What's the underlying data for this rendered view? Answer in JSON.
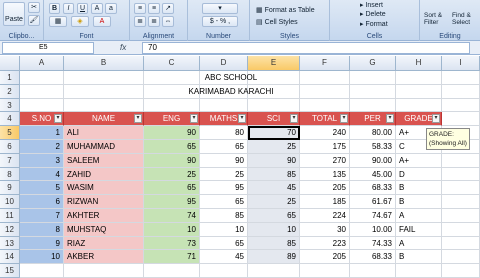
{
  "ribbon": {
    "paste": "Paste",
    "clipboard": "Clipbo...",
    "font": "Font",
    "alignment": "Alignment",
    "number": "Number",
    "styles": "Styles",
    "cells": "Cells",
    "editing": "Editing",
    "currency": "$ - % ,",
    "format_as_table": "Format as Table",
    "cell_styles": "Cell Styles",
    "insert": "Insert",
    "delete": "Delete",
    "format": "Format",
    "sort_filter": "Sort & Filter",
    "find_select": "Find & Select",
    "bold": "B",
    "italic": "I",
    "underline": "U"
  },
  "formula_bar": {
    "name_box": "E5",
    "fx": "fx",
    "value": "70"
  },
  "columns": [
    "A",
    "B",
    "C",
    "D",
    "E",
    "F",
    "G",
    "H",
    "I"
  ],
  "selected_column": "E",
  "rows": [
    "1",
    "2",
    "3",
    "4",
    "5",
    "6",
    "7",
    "8",
    "9",
    "10",
    "11",
    "12",
    "13",
    "14",
    "15"
  ],
  "title1": "ABC SCHOOL",
  "title2": "KARIMABAD KARACHI",
  "headers": [
    "S.NO",
    "NAME",
    "ENG",
    "MATHS",
    "SCI",
    "TOTAL",
    "PER",
    "GRADE"
  ],
  "students": [
    {
      "sno": "1",
      "name": "ALI",
      "eng": "90",
      "maths": "80",
      "sci": "70",
      "total": "240",
      "per": "80.00",
      "grade": "A+"
    },
    {
      "sno": "2",
      "name": "MUHAMMAD",
      "eng": "65",
      "maths": "65",
      "sci": "25",
      "total": "175",
      "per": "58.33",
      "grade": "C"
    },
    {
      "sno": "3",
      "name": "SALEEM",
      "eng": "90",
      "maths": "90",
      "sci": "90",
      "total": "270",
      "per": "90.00",
      "grade": "A+"
    },
    {
      "sno": "4",
      "name": "ZAHID",
      "eng": "25",
      "maths": "25",
      "sci": "85",
      "total": "135",
      "per": "45.00",
      "grade": "D"
    },
    {
      "sno": "5",
      "name": "WASIM",
      "eng": "65",
      "maths": "95",
      "sci": "45",
      "total": "205",
      "per": "68.33",
      "grade": "B"
    },
    {
      "sno": "6",
      "name": "RIZWAN",
      "eng": "95",
      "maths": "65",
      "sci": "25",
      "total": "185",
      "per": "61.67",
      "grade": "B"
    },
    {
      "sno": "7",
      "name": "AKHTER",
      "eng": "74",
      "maths": "85",
      "sci": "65",
      "total": "224",
      "per": "74.67",
      "grade": "A"
    },
    {
      "sno": "8",
      "name": "MUHSTAQ",
      "eng": "10",
      "maths": "10",
      "sci": "10",
      "total": "30",
      "per": "10.00",
      "grade": "FAIL"
    },
    {
      "sno": "9",
      "name": "RIAZ",
      "eng": "73",
      "maths": "65",
      "sci": "85",
      "total": "223",
      "per": "74.33",
      "grade": "A"
    },
    {
      "sno": "10",
      "name": "AKBER",
      "eng": "71",
      "maths": "45",
      "sci": "89",
      "total": "205",
      "per": "68.33",
      "grade": "B"
    }
  ],
  "tooltip": {
    "line1": "GRADE:",
    "line2": "(Showing All)"
  },
  "colors": {
    "header_red": "#d9534f",
    "sno_blue": "#a9c4e8",
    "name_pink": "#f4c7c7",
    "eng_green": "#c6e3b5",
    "sci_gray": "#e4e8ef"
  }
}
